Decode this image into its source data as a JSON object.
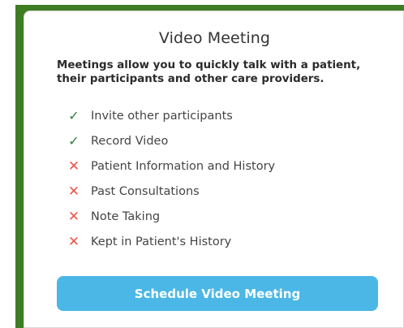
{
  "card": {
    "title": "Video Meeting",
    "description": "Meetings allow you to quickly talk with a patient, their participants and other care providers.",
    "features": [
      {
        "label": "Invite other participants",
        "included": true,
        "icon": "check-icon",
        "symbol": "✓"
      },
      {
        "label": "Record Video",
        "included": true,
        "icon": "check-icon",
        "symbol": "✓"
      },
      {
        "label": "Patient Information and History",
        "included": false,
        "icon": "cross-icon",
        "symbol": "✕"
      },
      {
        "label": "Past Consultations",
        "included": false,
        "icon": "cross-icon",
        "symbol": "✕"
      },
      {
        "label": "Note Taking",
        "included": false,
        "icon": "cross-icon",
        "symbol": "✕"
      },
      {
        "label": "Kept in Patient's History",
        "included": false,
        "icon": "cross-icon",
        "symbol": "✕"
      }
    ],
    "cta_label": "Schedule Video Meeting"
  },
  "colors": {
    "frame": "#3f7d24",
    "check": "#2e7d32",
    "cross": "#e8584c",
    "button": "#4bb7e6"
  }
}
